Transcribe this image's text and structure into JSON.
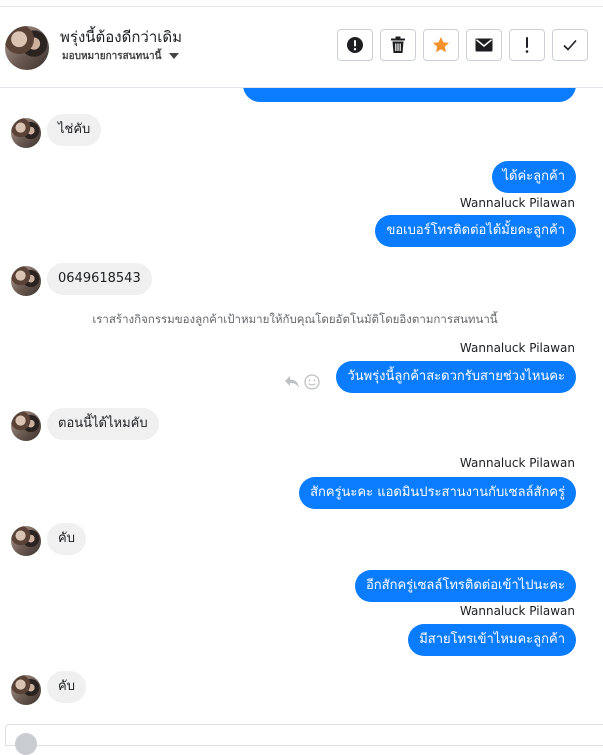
{
  "header": {
    "title": "พรุ่งนี้ต้องดีกว่าเดิม",
    "subtitle": "มอบหมายการสนทนานี้",
    "toolbar": [
      {
        "name": "spam-button",
        "icon": "exclamation-circle-icon"
      },
      {
        "name": "delete-button",
        "icon": "trash-icon"
      },
      {
        "name": "star-button",
        "icon": "star-icon",
        "color": "#f5922b"
      },
      {
        "name": "mark-unread-button",
        "icon": "envelope-icon"
      },
      {
        "name": "follow-up-button",
        "icon": "exclamation-icon"
      },
      {
        "name": "mark-done-button",
        "icon": "check-icon"
      }
    ]
  },
  "colors": {
    "outgoing": "#0a7cff",
    "incoming": "#f0f0f0",
    "star": "#f5922b"
  },
  "messages": {
    "m1": "ไช่คับ",
    "m2": "ได้ค่ะลูกค้า",
    "m2_sender": "Wannaluck Pilawan",
    "m3": "ขอเบอร์โทรติดต่อได้มั้ยคะลูกค้า",
    "m4": "0649618543",
    "system_note": "เราสร้างกิจกรรมของลูกค้าเป้าหมายให้กับคุณโดยอัตโนมัติโดยอิงตามการสนทนานี้",
    "m5_sender": "Wannaluck Pilawan",
    "m5": "วันพรุ่งนี้ลูกค้าสะดวกรับสายช่วงไหนคะ",
    "m6": "ตอนนี้ได้ไหมคับ",
    "m7_sender": "Wannaluck Pilawan",
    "m7": "สักครู่นะคะ  แอดมินประสานงานกับเซลล์สักครู่",
    "m8": "คับ",
    "m9": "อีกสักครู่เซลล์โทรติดต่อเข้าไปนะคะ",
    "m9_sender": "Wannaluck Pilawan",
    "m10": "มีสายโทรเข้าไหมคะลูกค้า",
    "m11": "คับ"
  }
}
